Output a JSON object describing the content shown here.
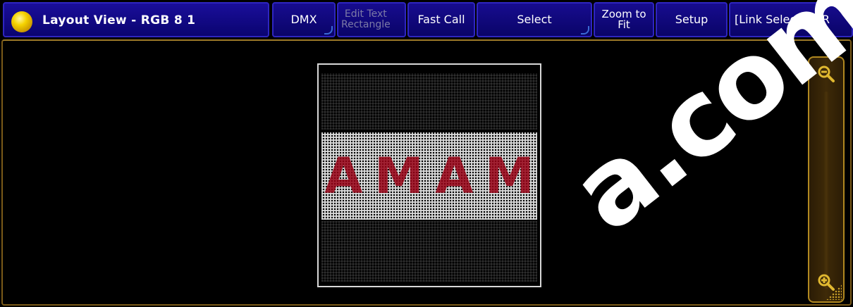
{
  "window": {
    "title": "Layout View - RGB 8 1"
  },
  "toolbar": {
    "buttons": [
      {
        "label": "DMX"
      },
      {
        "label": "Edit Text\nRectangle"
      },
      {
        "label": "Fast Call"
      },
      {
        "label": "Select"
      },
      {
        "label": "Zoom to\nFit"
      },
      {
        "label": "Setup"
      },
      {
        "label": "[Link Selected: R"
      }
    ]
  },
  "canvas": {
    "letters": [
      "A",
      "M",
      "A",
      "M"
    ]
  },
  "zoom": {
    "zoom_out_icon": "zoom-out-icon",
    "zoom_in_icon": "zoom-in-icon"
  },
  "watermark": {
    "text": "a.com."
  },
  "colors": {
    "title_bar": "#0a0470",
    "button_border": "#2e25c0",
    "frame_border": "#9c7a28",
    "pixel_red": "#960014"
  }
}
